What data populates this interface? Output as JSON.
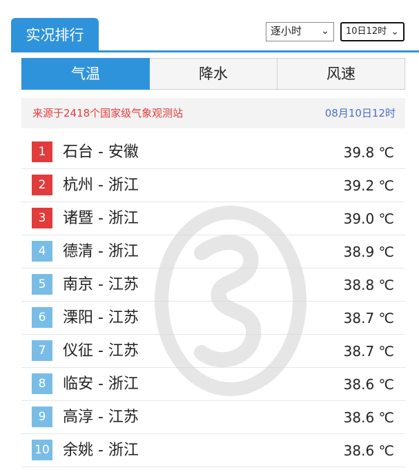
{
  "header": {
    "title": "实况排行",
    "mode_select": "逐小时",
    "time_select": "10日12时"
  },
  "tabs": [
    {
      "label": "气温",
      "active": true
    },
    {
      "label": "降水",
      "active": false
    },
    {
      "label": "风速",
      "active": false
    }
  ],
  "source": {
    "text": "来源于2418个国家级气象观测站",
    "time": "08月10日12时"
  },
  "colors": {
    "accent": "#2f93dc",
    "top_rank": "#e23b3b",
    "normal_rank": "#79bde6",
    "source_text": "#e23b3b",
    "source_time": "#4b6fd1"
  },
  "ranking": [
    {
      "rank": "1",
      "name": "石台 - 安徽",
      "value": "39.8 ℃"
    },
    {
      "rank": "2",
      "name": "杭州 - 浙江",
      "value": "39.2 ℃"
    },
    {
      "rank": "3",
      "name": "诸暨 - 浙江",
      "value": "39.0 ℃"
    },
    {
      "rank": "4",
      "name": "德清 - 浙江",
      "value": "38.9 ℃"
    },
    {
      "rank": "5",
      "name": "南京 - 江苏",
      "value": "38.8 ℃"
    },
    {
      "rank": "6",
      "name": "溧阳 - 江苏",
      "value": "38.7 ℃"
    },
    {
      "rank": "7",
      "name": "仪征 - 江苏",
      "value": "38.7 ℃"
    },
    {
      "rank": "8",
      "name": "临安 - 浙江",
      "value": "38.6 ℃"
    },
    {
      "rank": "9",
      "name": "高淳 - 江苏",
      "value": "38.6 ℃"
    },
    {
      "rank": "10",
      "name": "余姚 - 浙江",
      "value": "38.6 ℃"
    }
  ]
}
